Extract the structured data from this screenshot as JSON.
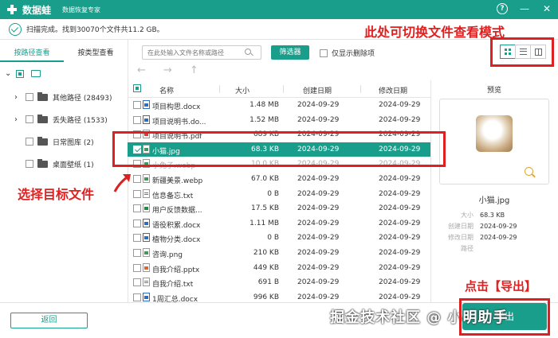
{
  "app": {
    "name": "数据蛙",
    "subtitle": "数据恢复专家"
  },
  "status": {
    "text": "扫描完成。找到30070个文件共11.2 GB。"
  },
  "annotations": {
    "top": "此处可切换文件查看模式",
    "left": "选择目标文件",
    "bottom": "点击【导出】"
  },
  "left_tabs": [
    "按路径查看",
    "按类型查看"
  ],
  "tree": [
    {
      "label": "其他路径 (28493)",
      "expandable": true
    },
    {
      "label": "丢失路径 (1533)",
      "expandable": true
    },
    {
      "label": "日常图库 (2)",
      "expandable": false
    },
    {
      "label": "桌面壁纸 (1)",
      "expandable": false
    }
  ],
  "toolbar": {
    "search_placeholder": "在此处输入文件名称或路径",
    "filter_label": "筛选器",
    "only_deleted_label": "仅显示删除项"
  },
  "nav": {
    "back": "←",
    "forward": "→",
    "up": "↑"
  },
  "table": {
    "headers": {
      "name": "名称",
      "size": "大小",
      "created": "创建日期",
      "modified": "修改日期"
    },
    "rows": [
      {
        "name": "项目构思.docx",
        "size": "1.48 MB",
        "created": "2024-09-29",
        "modified": "2024-09-29",
        "type": "doc"
      },
      {
        "name": "项目说明书.do...",
        "size": "1.52 MB",
        "created": "2024-09-29",
        "modified": "2024-09-29",
        "type": "doc"
      },
      {
        "name": "项目说明书.pdf",
        "size": "689 KB",
        "created": "2024-09-29",
        "modified": "2024-09-29",
        "type": "pdf"
      },
      {
        "name": "小猫.jpg",
        "size": "68.3 KB",
        "created": "2024-09-29",
        "modified": "2024-09-29",
        "type": "img"
      },
      {
        "name": "小兔子.webp",
        "size": "10.0 KB",
        "created": "2024-09-29",
        "modified": "2024-09-29",
        "type": "img"
      },
      {
        "name": "新疆美景.webp",
        "size": "67.0 KB",
        "created": "2024-09-29",
        "modified": "2024-09-29",
        "type": "img"
      },
      {
        "name": "信息备忘.txt",
        "size": "0 B",
        "created": "2024-09-29",
        "modified": "2024-09-29",
        "type": "txt"
      },
      {
        "name": "用户反馈数据...",
        "size": "17.5 KB",
        "created": "2024-09-29",
        "modified": "2024-09-29",
        "type": "xls"
      },
      {
        "name": "语役积累.docx",
        "size": "1.11 MB",
        "created": "2024-09-29",
        "modified": "2024-09-29",
        "type": "doc"
      },
      {
        "name": "植物分类.docx",
        "size": "0 B",
        "created": "2024-09-29",
        "modified": "2024-09-29",
        "type": "doc"
      },
      {
        "name": "咨询.png",
        "size": "210 KB",
        "created": "2024-09-29",
        "modified": "2024-09-29",
        "type": "img"
      },
      {
        "name": "自我介绍.pptx",
        "size": "449 KB",
        "created": "2024-09-29",
        "modified": "2024-09-29",
        "type": "ppt"
      },
      {
        "name": "自我介绍.txt",
        "size": "691 B",
        "created": "2024-09-29",
        "modified": "2024-09-29",
        "type": "txt"
      },
      {
        "name": "1周汇总.docx",
        "size": "996 KB",
        "created": "2024-09-29",
        "modified": "2024-09-29",
        "type": "doc"
      }
    ]
  },
  "preview": {
    "title": "预览",
    "file_name": "小猫.jpg",
    "meta": [
      {
        "k": "大小",
        "v": "68.3 KB"
      },
      {
        "k": "创建日期",
        "v": "2024-09-29"
      },
      {
        "k": "修改日期",
        "v": "2024-09-29"
      },
      {
        "k": "路径",
        "v": ""
      }
    ]
  },
  "bottom": {
    "back_label": "返回",
    "export_label": "导出"
  },
  "watermark": "掘金技术社区 @ 小明助手",
  "colors": {
    "brand": "#1a9e8c",
    "annotation": "#e02020"
  }
}
